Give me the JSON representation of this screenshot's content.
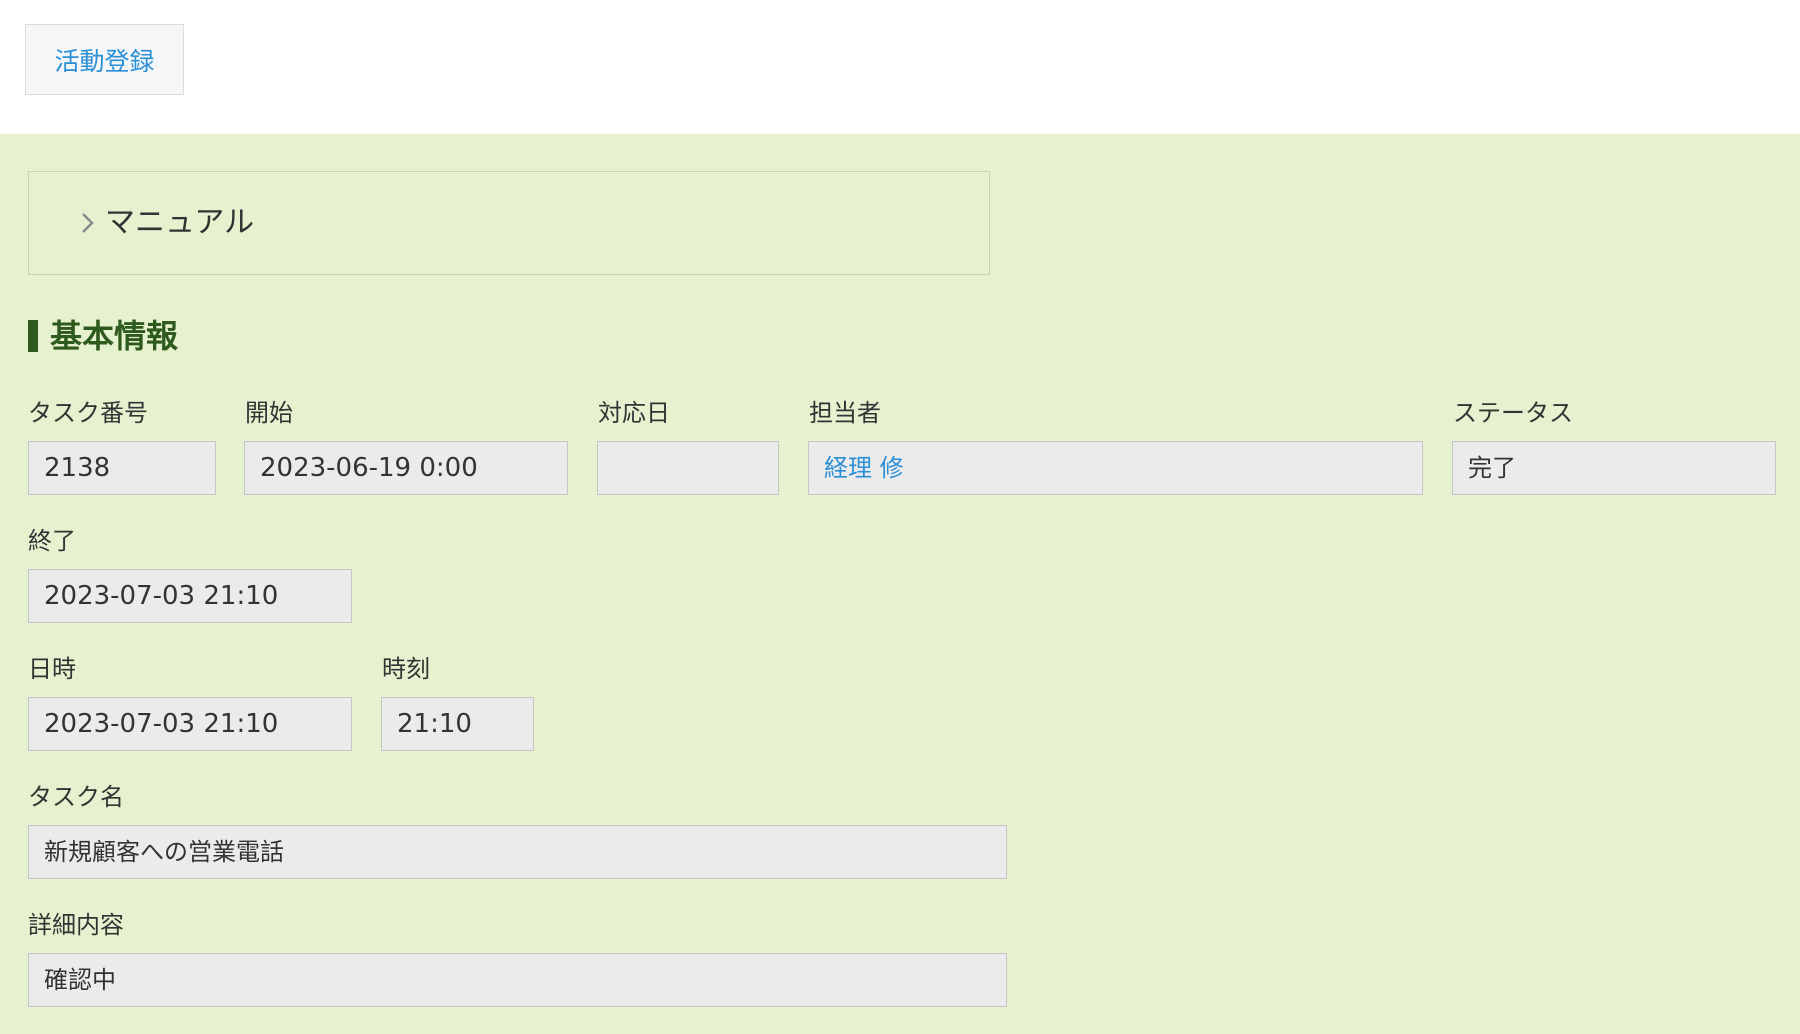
{
  "toolbar": {
    "register_label": "活動登録"
  },
  "manual": {
    "label": "マニュアル"
  },
  "section": {
    "title": "基本情報"
  },
  "fields": {
    "task_number": {
      "label": "タスク番号",
      "value": "2138"
    },
    "start": {
      "label": "開始",
      "value": "2023-06-19 0:00"
    },
    "response_date": {
      "label": "対応日",
      "value": ""
    },
    "assignee": {
      "label": "担当者",
      "value": "経理 修"
    },
    "status": {
      "label": "ステータス",
      "value": "完了"
    },
    "end": {
      "label": "終了",
      "value": "2023-07-03 21:10"
    },
    "datetime": {
      "label": "日時",
      "value": "2023-07-03 21:10"
    },
    "time": {
      "label": "時刻",
      "value": "21:10"
    },
    "task_name": {
      "label": "タスク名",
      "value": "新規顧客への営業電話"
    },
    "details": {
      "label": "詳細内容",
      "value": "確認中"
    }
  },
  "colors": {
    "accent_link": "#2b8fd6",
    "panel_background": "#e6f1cf",
    "section_title": "#2f5a1e",
    "field_background": "#ebebeb"
  }
}
